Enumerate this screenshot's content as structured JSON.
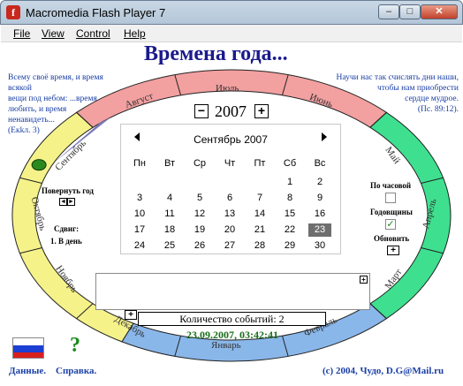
{
  "window": {
    "title": "Macromedia Flash Player 7",
    "app_icon": "f",
    "minimize": "–",
    "maximize": "□",
    "close": "✕"
  },
  "menu": [
    "File",
    "View",
    "Control",
    "Help"
  ],
  "header": {
    "title": "Времена года..."
  },
  "quote_left": [
    "Всему своё время, и время всякой",
    "вещи под небом: ...время",
    "любить, и время",
    "ненавидеть...",
    "(Екkл. 3)"
  ],
  "quote_right": [
    "Научи нас так счислять дни наши,",
    "чтобы нам приобрести",
    "сердце мудрое.",
    "(Пс. 89:12)."
  ],
  "months": {
    "jan": "Январь",
    "feb": "Февраль",
    "mar": "Март",
    "apr": "Апрель",
    "may": "Май",
    "jun": "Июнь",
    "jul": "Июль",
    "aug": "Август",
    "sep": "Сентябрь",
    "oct": "Октябрь",
    "nov": "Ноябрь",
    "dec": "Декабрь"
  },
  "year": {
    "value": "2007",
    "minus": "−",
    "plus": "+"
  },
  "calendar": {
    "title": "Сентябрь 2007",
    "weekdays": [
      "Пн",
      "Вт",
      "Ср",
      "Чт",
      "Пт",
      "Сб",
      "Вс"
    ],
    "weeks": [
      [
        "",
        "",
        "",
        "",
        "",
        "1",
        "2"
      ],
      [
        "3",
        "4",
        "5",
        "6",
        "7",
        "8",
        "9"
      ],
      [
        "10",
        "11",
        "12",
        "13",
        "14",
        "15",
        "16"
      ],
      [
        "17",
        "18",
        "19",
        "20",
        "21",
        "22",
        "23"
      ],
      [
        "24",
        "25",
        "26",
        "27",
        "28",
        "29",
        "30"
      ]
    ],
    "selected": "23"
  },
  "rotate": {
    "label": "Повернуть год",
    "left": "◄",
    "right": "►"
  },
  "shift": {
    "label": "Сдвиг:",
    "value": "1. В день"
  },
  "options": {
    "hourly": "По часовой",
    "anniversaries": "Годовщины",
    "refresh": "Обновить",
    "anniversaries_checked": true
  },
  "events": {
    "add": "+",
    "expand": "+",
    "count_text": "Количество событий: 2"
  },
  "datetime": "23.09.2007, 03:42:41",
  "footer": {
    "data": "Данные.",
    "help": "Справка.",
    "copyright": "(c) 2004, Чудо, D.G@Mail.ru"
  },
  "help_mark": "?",
  "colors": {
    "summer": "#f2a0a0",
    "autumn": "#f5f28a",
    "winter": "#8ab7ea",
    "spring": "#3ee08f",
    "title": "#1a1a8c"
  }
}
